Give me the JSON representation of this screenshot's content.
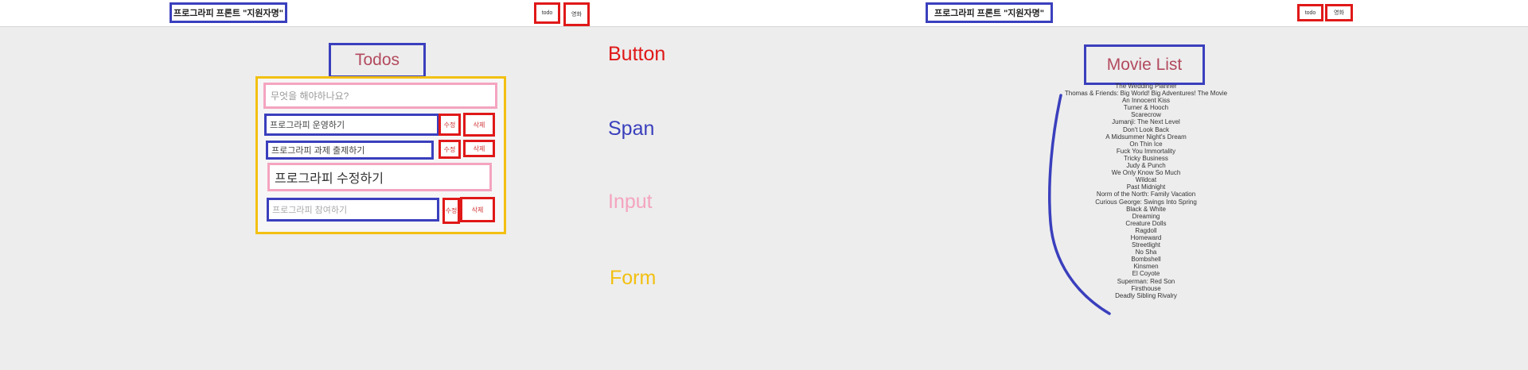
{
  "header_left": {
    "title": "프로그라피 프론트 \"지원자명\"",
    "buttons": [
      "todo",
      "영화"
    ]
  },
  "header_right": {
    "title": "프로그라피 프론트 \"지원자명\"",
    "buttons": [
      "todo",
      "영화"
    ]
  },
  "todos": {
    "title": "Todos",
    "new_input_placeholder": "무엇을 해야하나요?",
    "items": [
      {
        "text": "프로그라피 운영하기",
        "edit": "수정",
        "delete": "삭제"
      },
      {
        "text": "프로그라피 과제 출제하기",
        "edit": "수정",
        "delete": "삭제"
      },
      {
        "editing_value": "프로그라피 수정하기"
      },
      {
        "text": "프로그라피 참여하기",
        "edit": "수정",
        "delete": "삭제"
      }
    ]
  },
  "legend": [
    {
      "label": "Button",
      "color": "#e01818"
    },
    {
      "label": "Span",
      "color": "#3a3fbd"
    },
    {
      "label": "Input",
      "color": "#f4a4c0"
    },
    {
      "label": "Form",
      "color": "#f2c012"
    }
  ],
  "movies": {
    "title": "Movie List",
    "items": [
      "The Wedding Planner",
      "Thomas & Friends: Big World! Big Adventures! The Movie",
      "An Innocent Kiss",
      "Turner & Hooch",
      "Scarecrow",
      "Jumanji: The Next Level",
      "Don't Look Back",
      "A Midsummer Night's Dream",
      "On Thin Ice",
      "Fuck You Immortality",
      "Tricky Business",
      "Judy & Punch",
      "We Only Know So Much",
      "Wildcat",
      "Past Midnight",
      "Norm of the North: Family Vacation",
      "Curious George: Swings Into Spring",
      "Black & White",
      "Dreaming",
      "Creature Dolls",
      "Ragdoll",
      "Homeward",
      "Streetlight",
      "No Sha",
      "Bombshell",
      "Kinsmen",
      "El Coyote",
      "Superman: Red Son",
      "Firsthouse",
      "Deadly Sibling Rivalry"
    ]
  }
}
